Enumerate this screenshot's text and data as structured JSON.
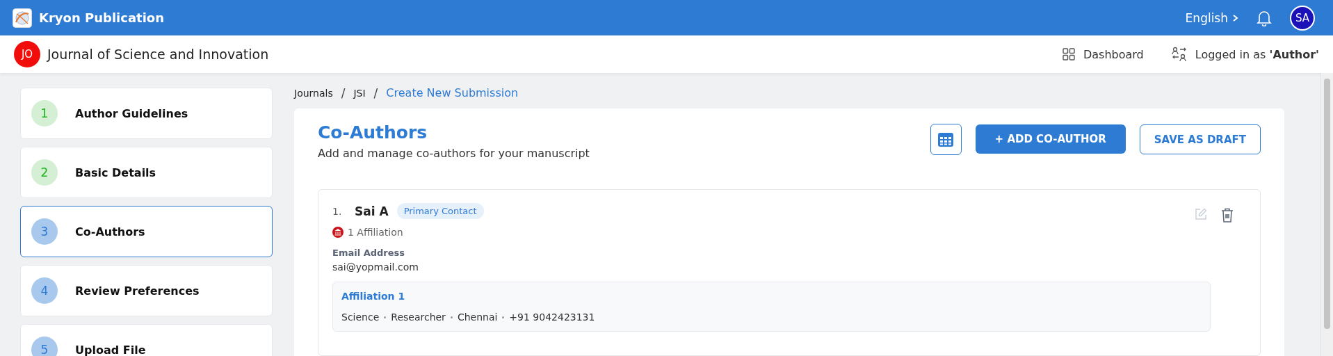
{
  "topbar": {
    "brand": "Kryon Publication",
    "language": "English",
    "avatar": "SA"
  },
  "subheader": {
    "journal_initials": "JO",
    "journal_title": "Journal of Science and Innovation",
    "dashboard": "Dashboard",
    "logged_in": "Logged in as **'Author'**"
  },
  "steps": [
    {
      "number": "1",
      "label": "Author Guidelines",
      "completed": true,
      "selected": false
    },
    {
      "number": "2",
      "label": "Basic Details",
      "completed": true,
      "selected": false
    },
    {
      "number": "3",
      "label": "Co-Authors",
      "completed": false,
      "selected": true
    },
    {
      "number": "4",
      "label": "Review Preferences",
      "completed": false,
      "selected": false
    },
    {
      "number": "5",
      "label": "Upload File",
      "completed": false,
      "selected": false
    }
  ],
  "breadcrumb_separator": "/",
  "breadcrumb": [
    {
      "label": "Journals",
      "current": false
    },
    {
      "label": "JSI",
      "current": false
    },
    {
      "label": "Create New Submission",
      "current": true
    }
  ],
  "section": {
    "title": "Co-Authors",
    "subtitle": "Add and manage co-authors for your manuscript",
    "add_button": "+ ADD CO-AUTHOR",
    "draft_button": "SAVE AS DRAFT"
  },
  "authors": [
    {
      "index": "1.",
      "name": "Sai A",
      "badge": "Primary Contact",
      "affiliation_count": "1 Affiliation",
      "email_label": "Email Address",
      "email": "sai@yopmail.com",
      "affiliations": [
        {
          "title": "Affiliation 1",
          "details": [
            "Science",
            "Researcher",
            "Chennai",
            "+91 9042423131"
          ]
        }
      ]
    }
  ]
}
